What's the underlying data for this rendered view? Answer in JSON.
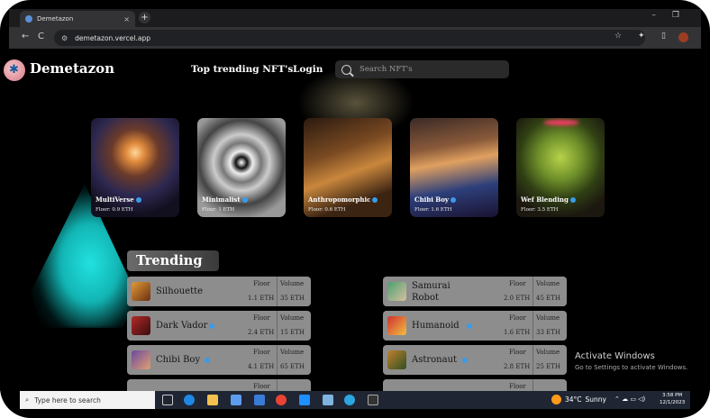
{
  "browser": {
    "tab_title": "Demetazon",
    "tab_close": "×",
    "new_tab": "+",
    "minimize": "–",
    "maximize": "❐",
    "back": "←",
    "reload": "C",
    "url": "demetazon.vercel.app"
  },
  "header": {
    "brand": "Demetazon",
    "nav_top_trending": "Top trending NFT's",
    "nav_login": "Login",
    "search_placeholder": "Search NFT's"
  },
  "collections": [
    {
      "name": "MultiVerse",
      "floor": "Floor: 0.9 ETH"
    },
    {
      "name": "Minimalist",
      "floor": "Floor: 1 ETH"
    },
    {
      "name": "Anthropomorphic",
      "floor": "Floor: 0.6 ETH"
    },
    {
      "name": "Chibi Boy",
      "floor": "Floor: 1.6 ETH"
    },
    {
      "name": "Wef Blending",
      "floor": "Floor: 3.5 ETH"
    }
  ],
  "trending": {
    "title": "Trending",
    "floor_label": "Floor",
    "volume_label": "Volume",
    "items": [
      {
        "name": "Silhouette",
        "floor": "1.1 ETH",
        "volume": "35 ETH",
        "verified": false
      },
      {
        "name": "Samurai Robot",
        "name_line1": "Samurai",
        "name_line2": "Robot",
        "floor": "2.0 ETH",
        "volume": "45 ETH",
        "verified": false
      },
      {
        "name": "Dark Vador",
        "floor": "2.4 ETH",
        "volume": "15 ETH",
        "verified": true
      },
      {
        "name": "Humanoid",
        "floor": "1.6 ETH",
        "volume": "33 ETH",
        "verified": true
      },
      {
        "name": "Chibi Boy",
        "floor": "4.1 ETH",
        "volume": "65 ETH",
        "verified": true
      },
      {
        "name": "Astronaut",
        "floor": "2.8 ETH",
        "volume": "25 ETH",
        "verified": true
      },
      {
        "name": "",
        "floor": "",
        "volume": "",
        "verified": false
      },
      {
        "name": "",
        "floor": "",
        "volume": "",
        "verified": false
      }
    ]
  },
  "windows_watermark": {
    "line1": "Activate Windows",
    "line2": "Go to Settings to activate Windows."
  },
  "taskbar": {
    "search_placeholder": "Type here to search",
    "temperature": "34°C",
    "weather": "Sunny",
    "time": "3:58 PM",
    "date": "12/1/2023"
  },
  "colors": {
    "accent_cyan": "#21e2e0",
    "verified_blue": "#3a9be8",
    "row_grey": "#8d8d8d"
  }
}
